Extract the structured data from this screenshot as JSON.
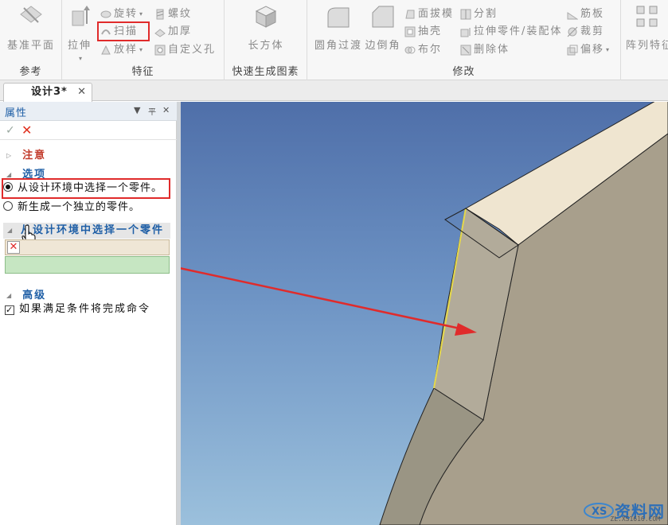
{
  "ribbon": {
    "groups": [
      {
        "label": "参考",
        "buttons": [
          "基准平面"
        ]
      },
      {
        "label": "特征",
        "big": "拉伸",
        "small": [
          "旋转",
          "扫描",
          "放样",
          "螺纹",
          "加厚",
          "自定义孔"
        ]
      },
      {
        "label": "快速生成图素",
        "big": "长方体"
      },
      {
        "label": "修改",
        "big": [
          "圆角过渡",
          "边倒角"
        ],
        "small": [
          "面拔模",
          "抽壳",
          "布尔",
          "分割",
          "拉伸零件/装配体",
          "删除体",
          "筋板",
          "裁剪",
          "偏移"
        ]
      },
      {
        "big": "阵列特征"
      }
    ]
  },
  "tab": {
    "label": "设计3*",
    "close": "✕"
  },
  "panel": {
    "title": "属性",
    "pin": "▾ 平 ✕",
    "ok": "✓",
    "cancel": "✕",
    "notice": "注意",
    "options": "选项",
    "option1": "从设计环境中选择一个零件。",
    "option2": "新生成一个独立的零件。",
    "sub_header": "从设计环境中选择一个零件",
    "advanced": "高级",
    "auto_finish": "如果满足条件将完成命令"
  },
  "watermark": {
    "text": "资料网",
    "url": "ZL.XS1616.COM"
  },
  "colors": {
    "accent_red": "#e02b2b",
    "title_blue": "#1f5fa6",
    "viewport_top": "#4f6fa9",
    "viewport_bottom": "#9bc0dc"
  }
}
